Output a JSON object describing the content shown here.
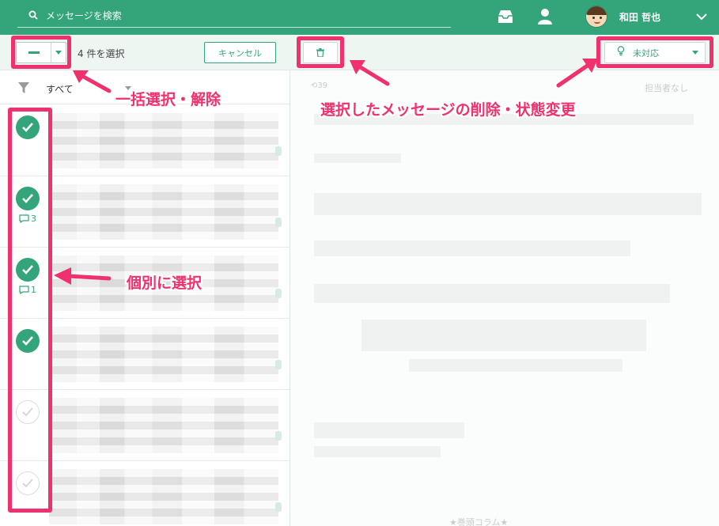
{
  "header": {
    "search_placeholder": "メッセージを検索",
    "user_name": "和田 哲也"
  },
  "list_toolbar": {
    "selected_count": "4 件を選択",
    "cancel_label": "キャンセル"
  },
  "filter": {
    "label": "すべて"
  },
  "messages": [
    {
      "checked": true,
      "comments": ""
    },
    {
      "checked": true,
      "comments": "3"
    },
    {
      "checked": true,
      "comments": "1"
    },
    {
      "checked": true,
      "comments": ""
    },
    {
      "checked": false,
      "comments": ""
    },
    {
      "checked": false,
      "comments": ""
    }
  ],
  "detail_toolbar": {
    "status_label": "未対応",
    "reply_count": "39",
    "assignee": "担当者なし"
  },
  "detail": {
    "bottom_text": "★巻頭コラム★"
  },
  "annotations": {
    "bulk_select": "一括選択・解除",
    "bulk_actions": "選択したメッセージの削除・状態変更",
    "individual_select": "個別に選択"
  },
  "colors": {
    "brand": "#34a57a",
    "annotation": "#f0316e"
  }
}
